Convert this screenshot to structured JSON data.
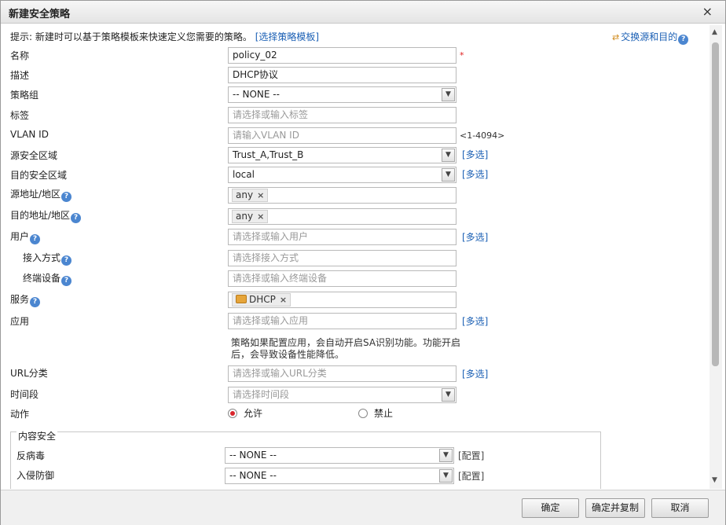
{
  "dialog": {
    "title": "新建安全策略",
    "close": "×"
  },
  "hint": {
    "text": "提示: 新建时可以基于策略模板来快速定义您需要的策略。",
    "link": "[选择策略模板]"
  },
  "swap_link": "交换源和目的",
  "form": {
    "name": {
      "label": "名称",
      "value": "policy_02",
      "required": "*"
    },
    "desc": {
      "label": "描述",
      "value": "DHCP协议"
    },
    "group": {
      "label": "策略组",
      "value": "-- NONE --"
    },
    "tag": {
      "label": "标签",
      "placeholder": "请选择或输入标签"
    },
    "vlan": {
      "label": "VLAN ID",
      "placeholder": "请输入VLAN ID",
      "range": "<1-4094>"
    },
    "src_zone": {
      "label": "源安全区域",
      "value": "Trust_A,Trust_B",
      "more": "[多选]"
    },
    "dst_zone": {
      "label": "目的安全区域",
      "value": "local",
      "more": "[多选]"
    },
    "src_addr": {
      "label": "源地址/地区",
      "tag": "any"
    },
    "dst_addr": {
      "label": "目的地址/地区",
      "tag": "any"
    },
    "user": {
      "label": "用户",
      "placeholder": "请选择或输入用户",
      "more": "[多选]"
    },
    "access": {
      "label": "接入方式",
      "placeholder": "请选择接入方式"
    },
    "device": {
      "label": "终端设备",
      "placeholder": "请选择或输入终端设备"
    },
    "service": {
      "label": "服务",
      "tag": "DHCP"
    },
    "app": {
      "label": "应用",
      "placeholder": "请选择或输入应用",
      "more": "[多选]",
      "note_line1": "策略如果配置应用，会自动开启SA识别功能。功能开启",
      "note_line2": "后，会导致设备性能降低。"
    },
    "url": {
      "label": "URL分类",
      "placeholder": "请选择或输入URL分类",
      "more": "[多选]"
    },
    "time": {
      "label": "时间段",
      "placeholder": "请选择时间段"
    },
    "action": {
      "label": "动作",
      "allow": "允许",
      "deny": "禁止",
      "selected": "allow"
    }
  },
  "content_security": {
    "legend": "内容安全",
    "antivirus": {
      "label": "反病毒",
      "value": "-- NONE --",
      "config": "[配置]"
    },
    "ips": {
      "label": "入侵防御",
      "value": "-- NONE --",
      "config": "[配置]"
    }
  },
  "buttons": {
    "ok": "确定",
    "ok_copy": "确定并复制",
    "cancel": "取消"
  }
}
